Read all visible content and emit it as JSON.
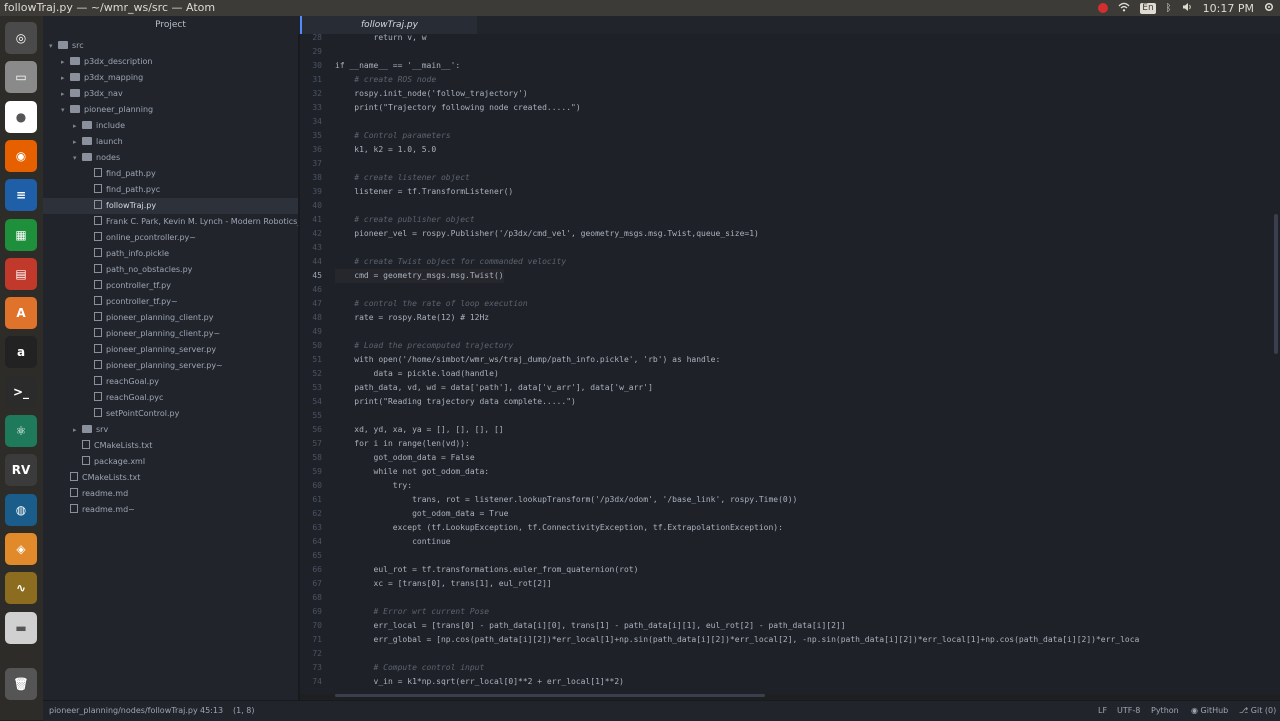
{
  "window": {
    "title": "followTraj.py — ~/wmr_ws/src — Atom",
    "clock": "10:17 PM",
    "lang": "En"
  },
  "launcher": [
    "ubuntu-logo-icon",
    "files-icon",
    "chrome-icon",
    "firefox-icon",
    "writer-icon",
    "calc-icon",
    "impress-icon",
    "software-center-icon",
    "amazon-icon",
    "terminal-icon",
    "atom-icon",
    "rviz-icon",
    "globe-icon",
    "sublime-icon",
    "waveform-icon",
    "drive-icon",
    "trash-icon"
  ],
  "tabs": {
    "project": "Project",
    "file": "followTraj.py"
  },
  "tree": [
    {
      "label": "src",
      "depth": 0,
      "type": "dir",
      "open": true
    },
    {
      "label": "p3dx_description",
      "depth": 1,
      "type": "dir",
      "open": false
    },
    {
      "label": "p3dx_mapping",
      "depth": 1,
      "type": "dir",
      "open": false
    },
    {
      "label": "p3dx_nav",
      "depth": 1,
      "type": "dir",
      "open": false
    },
    {
      "label": "pioneer_planning",
      "depth": 1,
      "type": "dir",
      "open": true
    },
    {
      "label": "include",
      "depth": 2,
      "type": "dir",
      "open": false
    },
    {
      "label": "launch",
      "depth": 2,
      "type": "dir",
      "open": false
    },
    {
      "label": "nodes",
      "depth": 2,
      "type": "dir",
      "open": true
    },
    {
      "label": "find_path.py",
      "depth": 3,
      "type": "file"
    },
    {
      "label": "find_path.pyc",
      "depth": 3,
      "type": "file"
    },
    {
      "label": "followTraj.py",
      "depth": 3,
      "type": "file",
      "selected": true
    },
    {
      "label": "Frank C. Park, Kevin M. Lynch - Modern Robotics_ Me",
      "depth": 3,
      "type": "file"
    },
    {
      "label": "online_pcontroller.py~",
      "depth": 3,
      "type": "file"
    },
    {
      "label": "path_info.pickle",
      "depth": 3,
      "type": "file"
    },
    {
      "label": "path_no_obstacles.py",
      "depth": 3,
      "type": "file"
    },
    {
      "label": "pcontroller_tf.py",
      "depth": 3,
      "type": "file"
    },
    {
      "label": "pcontroller_tf.py~",
      "depth": 3,
      "type": "file"
    },
    {
      "label": "pioneer_planning_client.py",
      "depth": 3,
      "type": "file"
    },
    {
      "label": "pioneer_planning_client.py~",
      "depth": 3,
      "type": "file"
    },
    {
      "label": "pioneer_planning_server.py",
      "depth": 3,
      "type": "file"
    },
    {
      "label": "pioneer_planning_server.py~",
      "depth": 3,
      "type": "file"
    },
    {
      "label": "reachGoal.py",
      "depth": 3,
      "type": "file"
    },
    {
      "label": "reachGoal.pyc",
      "depth": 3,
      "type": "file"
    },
    {
      "label": "setPointControl.py",
      "depth": 3,
      "type": "file"
    },
    {
      "label": "srv",
      "depth": 2,
      "type": "dir",
      "open": false
    },
    {
      "label": "CMakeLists.txt",
      "depth": 2,
      "type": "file"
    },
    {
      "label": "package.xml",
      "depth": 2,
      "type": "file"
    },
    {
      "label": "CMakeLists.txt",
      "depth": 1,
      "type": "file"
    },
    {
      "label": "readme.md",
      "depth": 1,
      "type": "file"
    },
    {
      "label": "readme.md~",
      "depth": 1,
      "type": "file"
    }
  ],
  "code": [
    {
      "n": "28",
      "t": "        return v, w",
      "c": false
    },
    {
      "n": "29",
      "t": "",
      "c": false
    },
    {
      "n": "30",
      "t": "if __name__ == '__main__':",
      "c": false
    },
    {
      "n": "31",
      "t": "    # create ROS node",
      "c": true
    },
    {
      "n": "32",
      "t": "    rospy.init_node('follow_trajectory')",
      "c": false
    },
    {
      "n": "33",
      "t": "    print(\"Trajectory following node created.....\")",
      "c": false
    },
    {
      "n": "34",
      "t": "",
      "c": false
    },
    {
      "n": "35",
      "t": "    # Control parameters",
      "c": true
    },
    {
      "n": "36",
      "t": "    k1, k2 = 1.0, 5.0",
      "c": false
    },
    {
      "n": "37",
      "t": "",
      "c": false
    },
    {
      "n": "38",
      "t": "    # create listener object",
      "c": true
    },
    {
      "n": "39",
      "t": "    listener = tf.TransformListener()",
      "c": false
    },
    {
      "n": "40",
      "t": "",
      "c": false
    },
    {
      "n": "41",
      "t": "    # create publisher object",
      "c": true
    },
    {
      "n": "42",
      "t": "    pioneer_vel = rospy.Publisher('/p3dx/cmd_vel', geometry_msgs.msg.Twist,queue_size=1)",
      "c": false
    },
    {
      "n": "43",
      "t": "",
      "c": false
    },
    {
      "n": "44",
      "t": "    # create Twist object for commanded velocity",
      "c": true
    },
    {
      "n": "45",
      "t": "    cmd = geometry_msgs.msg.Twist()",
      "c": false
    },
    {
      "n": "46",
      "t": "",
      "c": false
    },
    {
      "n": "47",
      "t": "    # control the rate of loop execution",
      "c": true
    },
    {
      "n": "48",
      "t": "    rate = rospy.Rate(12) # 12Hz",
      "c": false
    },
    {
      "n": "49",
      "t": "",
      "c": false
    },
    {
      "n": "50",
      "t": "    # Load the precomputed trajectory",
      "c": true
    },
    {
      "n": "51",
      "t": "    with open('/home/simbot/wmr_ws/traj_dump/path_info.pickle', 'rb') as handle:",
      "c": false
    },
    {
      "n": "52",
      "t": "        data = pickle.load(handle)",
      "c": false
    },
    {
      "n": "53",
      "t": "    path_data, vd, wd = data['path'], data['v_arr'], data['w_arr']",
      "c": false
    },
    {
      "n": "54",
      "t": "    print(\"Reading trajectory data complete.....\")",
      "c": false
    },
    {
      "n": "55",
      "t": "",
      "c": false
    },
    {
      "n": "56",
      "t": "    xd, yd, xa, ya = [], [], [], []",
      "c": false
    },
    {
      "n": "57",
      "t": "    for i in range(len(vd)):",
      "c": false
    },
    {
      "n": "58",
      "t": "        got_odom_data = False",
      "c": false
    },
    {
      "n": "59",
      "t": "        while not got_odom_data:",
      "c": false
    },
    {
      "n": "60",
      "t": "            try:",
      "c": false
    },
    {
      "n": "61",
      "t": "                trans, rot = listener.lookupTransform('/p3dx/odom', '/base_link', rospy.Time(0))",
      "c": false
    },
    {
      "n": "62",
      "t": "                got_odom_data = True",
      "c": false
    },
    {
      "n": "63",
      "t": "            except (tf.LookupException, tf.ConnectivityException, tf.ExtrapolationException):",
      "c": false
    },
    {
      "n": "64",
      "t": "                continue",
      "c": false
    },
    {
      "n": "65",
      "t": "",
      "c": false
    },
    {
      "n": "66",
      "t": "        eul_rot = tf.transformations.euler_from_quaternion(rot)",
      "c": false
    },
    {
      "n": "67",
      "t": "        xc = [trans[0], trans[1], eul_rot[2]]",
      "c": false
    },
    {
      "n": "68",
      "t": "",
      "c": false
    },
    {
      "n": "69",
      "t": "        # Error wrt current Pose",
      "c": true
    },
    {
      "n": "70",
      "t": "        err_local = [trans[0] - path_data[i][0], trans[1] - path_data[i][1], eul_rot[2] - path_data[i][2]]",
      "c": false
    },
    {
      "n": "71",
      "t": "        err_global = [np.cos(path_data[i][2])*err_local[1]+np.sin(path_data[i][2])*err_local[2], -np.sin(path_data[i][2])*err_local[1]+np.cos(path_data[i][2])*err_loca",
      "c": false
    },
    {
      "n": "72",
      "t": "",
      "c": false
    },
    {
      "n": "73",
      "t": "        # Compute control input",
      "c": true
    },
    {
      "n": "74",
      "t": "        v_in = k1*np.sqrt(err_local[0]**2 + err_local[1]**2)",
      "c": false
    }
  ],
  "status": {
    "path": "pioneer_planning/nodes/followTraj.py",
    "cursor": "45:13",
    "selection": "(1, 8)",
    "line_ending": "LF",
    "encoding": "UTF-8",
    "grammar": "Python",
    "github": "GitHub",
    "git": "Git (0)"
  }
}
